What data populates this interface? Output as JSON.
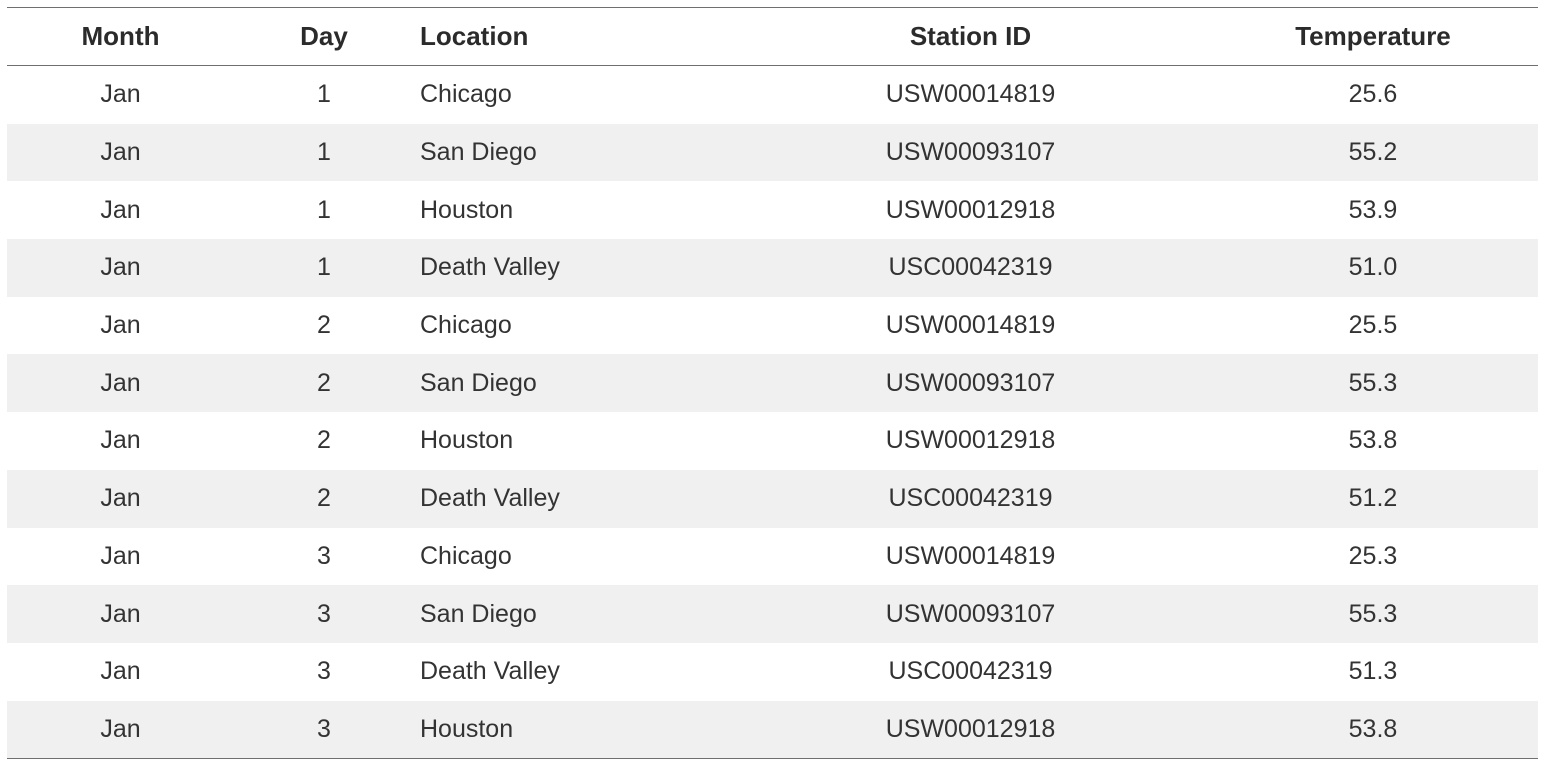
{
  "chart_data": {
    "type": "table",
    "columns": [
      "Month",
      "Day",
      "Location",
      "Station ID",
      "Temperature"
    ],
    "rows": [
      [
        "Jan",
        "1",
        "Chicago",
        "USW00014819",
        "25.6"
      ],
      [
        "Jan",
        "1",
        "San Diego",
        "USW00093107",
        "55.2"
      ],
      [
        "Jan",
        "1",
        "Houston",
        "USW00012918",
        "53.9"
      ],
      [
        "Jan",
        "1",
        "Death Valley",
        "USC00042319",
        "51.0"
      ],
      [
        "Jan",
        "2",
        "Chicago",
        "USW00014819",
        "25.5"
      ],
      [
        "Jan",
        "2",
        "San Diego",
        "USW00093107",
        "55.3"
      ],
      [
        "Jan",
        "2",
        "Houston",
        "USW00012918",
        "53.8"
      ],
      [
        "Jan",
        "2",
        "Death Valley",
        "USC00042319",
        "51.2"
      ],
      [
        "Jan",
        "3",
        "Chicago",
        "USW00014819",
        "25.3"
      ],
      [
        "Jan",
        "3",
        "San Diego",
        "USW00093107",
        "55.3"
      ],
      [
        "Jan",
        "3",
        "Death Valley",
        "USC00042319",
        "51.3"
      ],
      [
        "Jan",
        "3",
        "Houston",
        "USW00012918",
        "53.8"
      ]
    ],
    "colors": {
      "stripe": "#f0f0f0",
      "rule": "#6f6f6f",
      "text": "#2b2b2b"
    }
  }
}
